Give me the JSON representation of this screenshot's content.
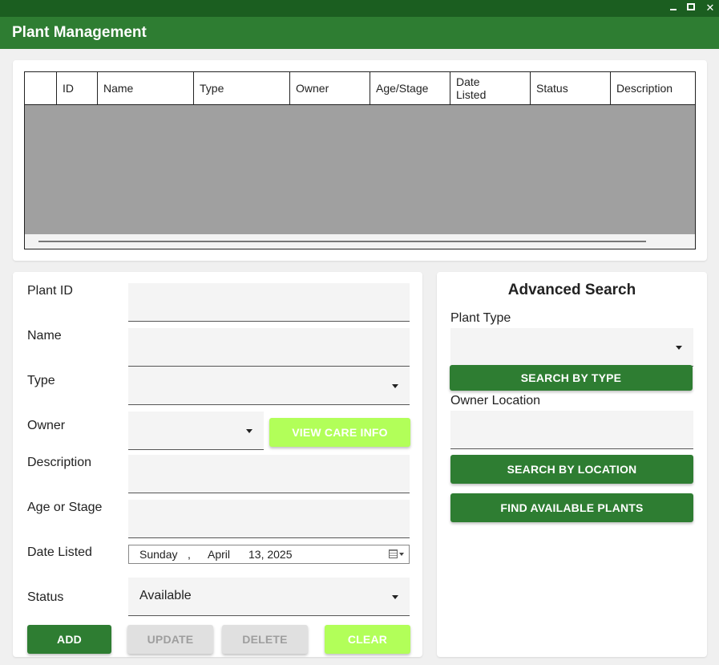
{
  "window": {
    "title": "Plant Management",
    "controls": [
      "minimize-icon",
      "maximize-icon",
      "close-icon"
    ]
  },
  "table": {
    "columns": [
      "",
      "ID",
      "Name",
      "Type",
      "Owner",
      "Age/Stage",
      "Date\nListed",
      "Status",
      "Description"
    ],
    "rows": []
  },
  "form": {
    "plant_id": {
      "label": "Plant ID",
      "value": ""
    },
    "name": {
      "label": "Name",
      "value": ""
    },
    "type": {
      "label": "Type",
      "value": ""
    },
    "owner": {
      "label": "Owner",
      "value": ""
    },
    "view_care_info": "VIEW CARE INFO",
    "description": {
      "label": "Description",
      "value": ""
    },
    "age": {
      "label": "Age or Stage",
      "value": ""
    },
    "date_listed": {
      "label": "Date Listed",
      "weekday": "Sunday",
      "sep": ",",
      "month": "April",
      "day_year": "13, 2025"
    },
    "status": {
      "label": "Status",
      "value": "Available"
    },
    "buttons": {
      "add": "ADD",
      "update": "UPDATE",
      "delete": "DELETE",
      "clear": "CLEAR"
    }
  },
  "search": {
    "title": "Advanced Search",
    "plant_type_label": "Plant Type",
    "plant_type_value": "",
    "search_by_type": "SEARCH BY TYPE",
    "owner_location_label": "Owner Location",
    "owner_location_value": "",
    "search_by_location": "SEARCH BY LOCATION",
    "find_available": "FIND AVAILABLE PLANTS"
  },
  "colors": {
    "titlebar": "#1b5e20",
    "header": "#2e7d32",
    "primary_button": "#2e7d32",
    "accent_button": "#b2ff59",
    "disabled_button": "#e0e0e0",
    "table_body": "#a0a0a0"
  }
}
